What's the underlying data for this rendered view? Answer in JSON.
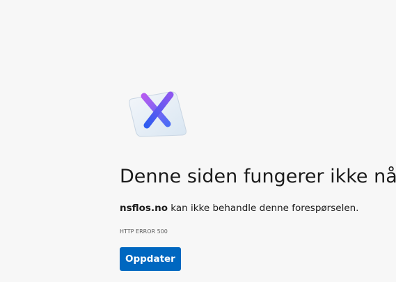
{
  "error_page": {
    "icon": "x-mark-on-paper-icon",
    "title": "Denne siden fungerer ikke nå",
    "message": {
      "host": "nsflos.no",
      "text": " kan ikke behandle denne forespørselen."
    },
    "error_code": "HTTP ERROR 500",
    "reload_button": "Oppdater"
  },
  "colors": {
    "background": "#f7f7f7",
    "button": "#0067c0",
    "text": "#1b1b1b"
  }
}
